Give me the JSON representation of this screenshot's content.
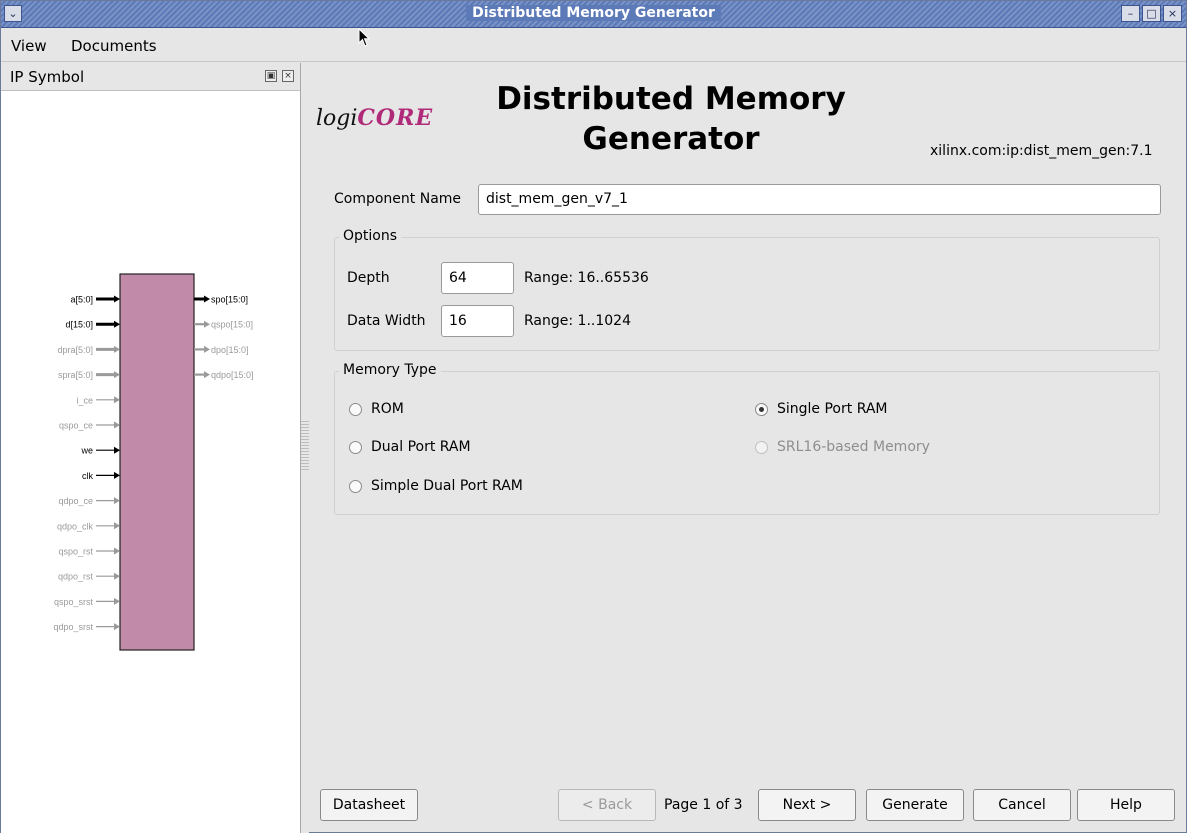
{
  "window": {
    "title": "Distributed Memory Generator"
  },
  "menubar": {
    "items": [
      "View",
      "Documents"
    ]
  },
  "left_panel": {
    "title": "IP Symbol",
    "symbol": {
      "block_color": "#c08aa8",
      "left_pins": [
        {
          "label": "a[5:0]",
          "active": true,
          "bus": true
        },
        {
          "label": "d[15:0]",
          "active": true,
          "bus": true
        },
        {
          "label": "dpra[5:0]",
          "active": false,
          "bus": true
        },
        {
          "label": "spra[5:0]",
          "active": false,
          "bus": true
        },
        {
          "label": "i_ce",
          "active": false,
          "bus": false
        },
        {
          "label": "qspo_ce",
          "active": false,
          "bus": false
        },
        {
          "label": "we",
          "active": true,
          "bus": false
        },
        {
          "label": "clk",
          "active": true,
          "bus": false
        },
        {
          "label": "qdpo_ce",
          "active": false,
          "bus": false
        },
        {
          "label": "qdpo_clk",
          "active": false,
          "bus": false
        },
        {
          "label": "qspo_rst",
          "active": false,
          "bus": false
        },
        {
          "label": "qdpo_rst",
          "active": false,
          "bus": false
        },
        {
          "label": "qspo_srst",
          "active": false,
          "bus": false
        },
        {
          "label": "qdpo_srst",
          "active": false,
          "bus": false
        }
      ],
      "right_pins": [
        {
          "label": "spo[15:0]",
          "active": true
        },
        {
          "label": "qspo[15:0]",
          "active": false
        },
        {
          "label": "dpo[15:0]",
          "active": false
        },
        {
          "label": "qdpo[15:0]",
          "active": false
        }
      ]
    }
  },
  "header": {
    "logo_prefix": "logi",
    "logo_core": "CORE",
    "title_line1": "Distributed Memory",
    "title_line2": "Generator",
    "ip_identifier": "xilinx.com:ip:dist_mem_gen:7.1"
  },
  "form": {
    "component_name_label": "Component Name",
    "component_name_value": "dist_mem_gen_v7_1",
    "options": {
      "title": "Options",
      "depth_label": "Depth",
      "depth_value": "64",
      "depth_range": "Range: 16..65536",
      "width_label": "Data Width",
      "width_value": "16",
      "width_range": "Range: 1..1024"
    },
    "memory_type": {
      "title": "Memory Type",
      "rom": "ROM",
      "dual_port_ram": "Dual Port RAM",
      "simple_dual_port_ram": "Simple Dual Port RAM",
      "single_port_ram": "Single Port RAM",
      "srl16": "SRL16-based Memory",
      "selected": "Single Port RAM"
    }
  },
  "footer": {
    "datasheet": "Datasheet",
    "back": "< Back",
    "page_info": "Page 1 of 3",
    "next": "Next >",
    "generate": "Generate",
    "cancel": "Cancel",
    "help": "Help"
  }
}
